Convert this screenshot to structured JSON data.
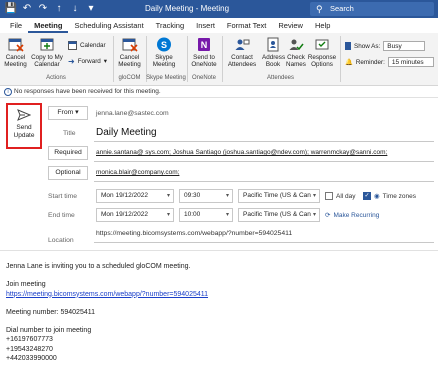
{
  "window": {
    "title": "Daily Meeting  -  Meeting",
    "search_placeholder": "Search"
  },
  "menu": {
    "tabs": [
      "File",
      "Meeting",
      "Scheduling Assistant",
      "Tracking",
      "Insert",
      "Format Text",
      "Review",
      "Help"
    ],
    "active": "Meeting"
  },
  "ribbon": {
    "cancel_meeting": "Cancel Meeting",
    "copy_to_calendar": "Copy to My Calendar",
    "calendar": "Calendar",
    "forward": "Forward",
    "actions_group": "Actions",
    "glocom_cancel": "Cancel Meeting",
    "glocom_group": "gloCOM",
    "skype_meeting": "Skype Meeting",
    "skype_group": "Skype Meeting",
    "send_onenote": "Send to OneNote",
    "onenote_group": "OneNote",
    "contact_attendees": "Contact Attendees",
    "address_book": "Address Book",
    "check_names": "Check Names",
    "response_options": "Response Options",
    "attendees_group": "Attendees",
    "show_as_label": "Show As:",
    "show_as_value": "Busy",
    "reminder_label": "Reminder:",
    "reminder_value": "15 minutes"
  },
  "info": {
    "text": "No responses have been received for this meeting."
  },
  "form": {
    "send_update": "Send Update",
    "from_label": "From",
    "from_value": "jenna.lane@sastec.com",
    "title_label": "Title",
    "title_value": "Daily Meeting",
    "required_label": "Required",
    "required_value": "annie.santana@ sys.com; Joshua Santiago (joshua.santiago@ndev.com); warrenmckay@sanni.com;",
    "optional_label": "Optional",
    "optional_value": "monica.blair@company.com;",
    "start_label": "Start time",
    "start_date": "Mon 19/12/2022",
    "start_time": "09:30",
    "start_tz": "Pacific Time (US & Can",
    "all_day": "All day",
    "time_zones": "Time zones",
    "end_label": "End time",
    "end_date": "Mon 19/12/2022",
    "end_time": "10:00",
    "end_tz": "Pacific Time (US & Can",
    "make_recurring": "Make Recurring",
    "location_label": "Location",
    "location_value": "https://meeting.bicomsystems.com/webapp/?number=594025411"
  },
  "body": {
    "invite": "Jenna Lane is inviting you to a scheduled gloCOM meeting.",
    "join_label": "Join meeting",
    "join_link": "https://meeting.bicomsystems.com/webapp/?number=594025411",
    "meeting_number": "Meeting number: 594025411",
    "dial_label": "Dial number to join meeting",
    "dial_numbers": [
      "+16197607773",
      "+19543248270",
      "+442033990000"
    ]
  }
}
